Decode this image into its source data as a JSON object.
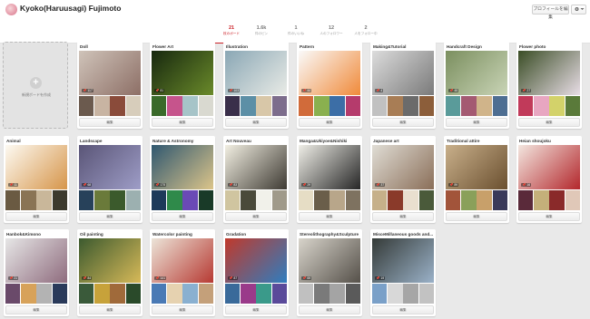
{
  "profile": {
    "name": "Kyoko(Haruusagi) Fujimoto",
    "edit_profile_label": "プロフィールを編集",
    "settings_icon": "gear-icon"
  },
  "stats": [
    {
      "count": "21",
      "label": "枚のボード"
    },
    {
      "count": "1.6k",
      "label": "件のピン"
    },
    {
      "count": "1",
      "label": "件のいいね"
    },
    {
      "count": "12",
      "label": "人のフォロワー"
    },
    {
      "count": "2",
      "label": "人をフォロー中"
    }
  ],
  "create_board": {
    "label": "新規ボードを作成"
  },
  "edit_label": "編集",
  "boards": [
    {
      "title": "Doll",
      "pins": "117"
    },
    {
      "title": "Flower Art",
      "pins": "81"
    },
    {
      "title": "Illustration",
      "pins": "103"
    },
    {
      "title": "Pattern",
      "pins": "44"
    },
    {
      "title": "Making&Tutorial",
      "pins": "4"
    },
    {
      "title": "Handcraft Design",
      "pins": "45"
    },
    {
      "title": "Flower photo",
      "pins": "27"
    },
    {
      "title": "Animal",
      "pins": "11"
    },
    {
      "title": "Landscape",
      "pins": "68"
    },
    {
      "title": "Nature & Astronomy",
      "pins": "175"
    },
    {
      "title": "Art Nouveau",
      "pins": "83"
    },
    {
      "title": "Manga&Ukiyoe&Nishiki",
      "pins": "29"
    },
    {
      "title": "Japanese art",
      "pins": "37"
    },
    {
      "title": "Traditional attire",
      "pins": "89"
    },
    {
      "title": "Heian shoujoku",
      "pins": "16"
    },
    {
      "title": "Hanbok&Kimono",
      "pins": "21"
    },
    {
      "title": "Oil painting",
      "pins": "84"
    },
    {
      "title": "Watercolor painting",
      "pins": "141"
    },
    {
      "title": "Gradation",
      "pins": "87"
    },
    {
      "title": "Stereolithography&Sculpture",
      "pins": "69"
    },
    {
      "title": "MisceMillaneous goods and...",
      "pins": "19"
    }
  ]
}
